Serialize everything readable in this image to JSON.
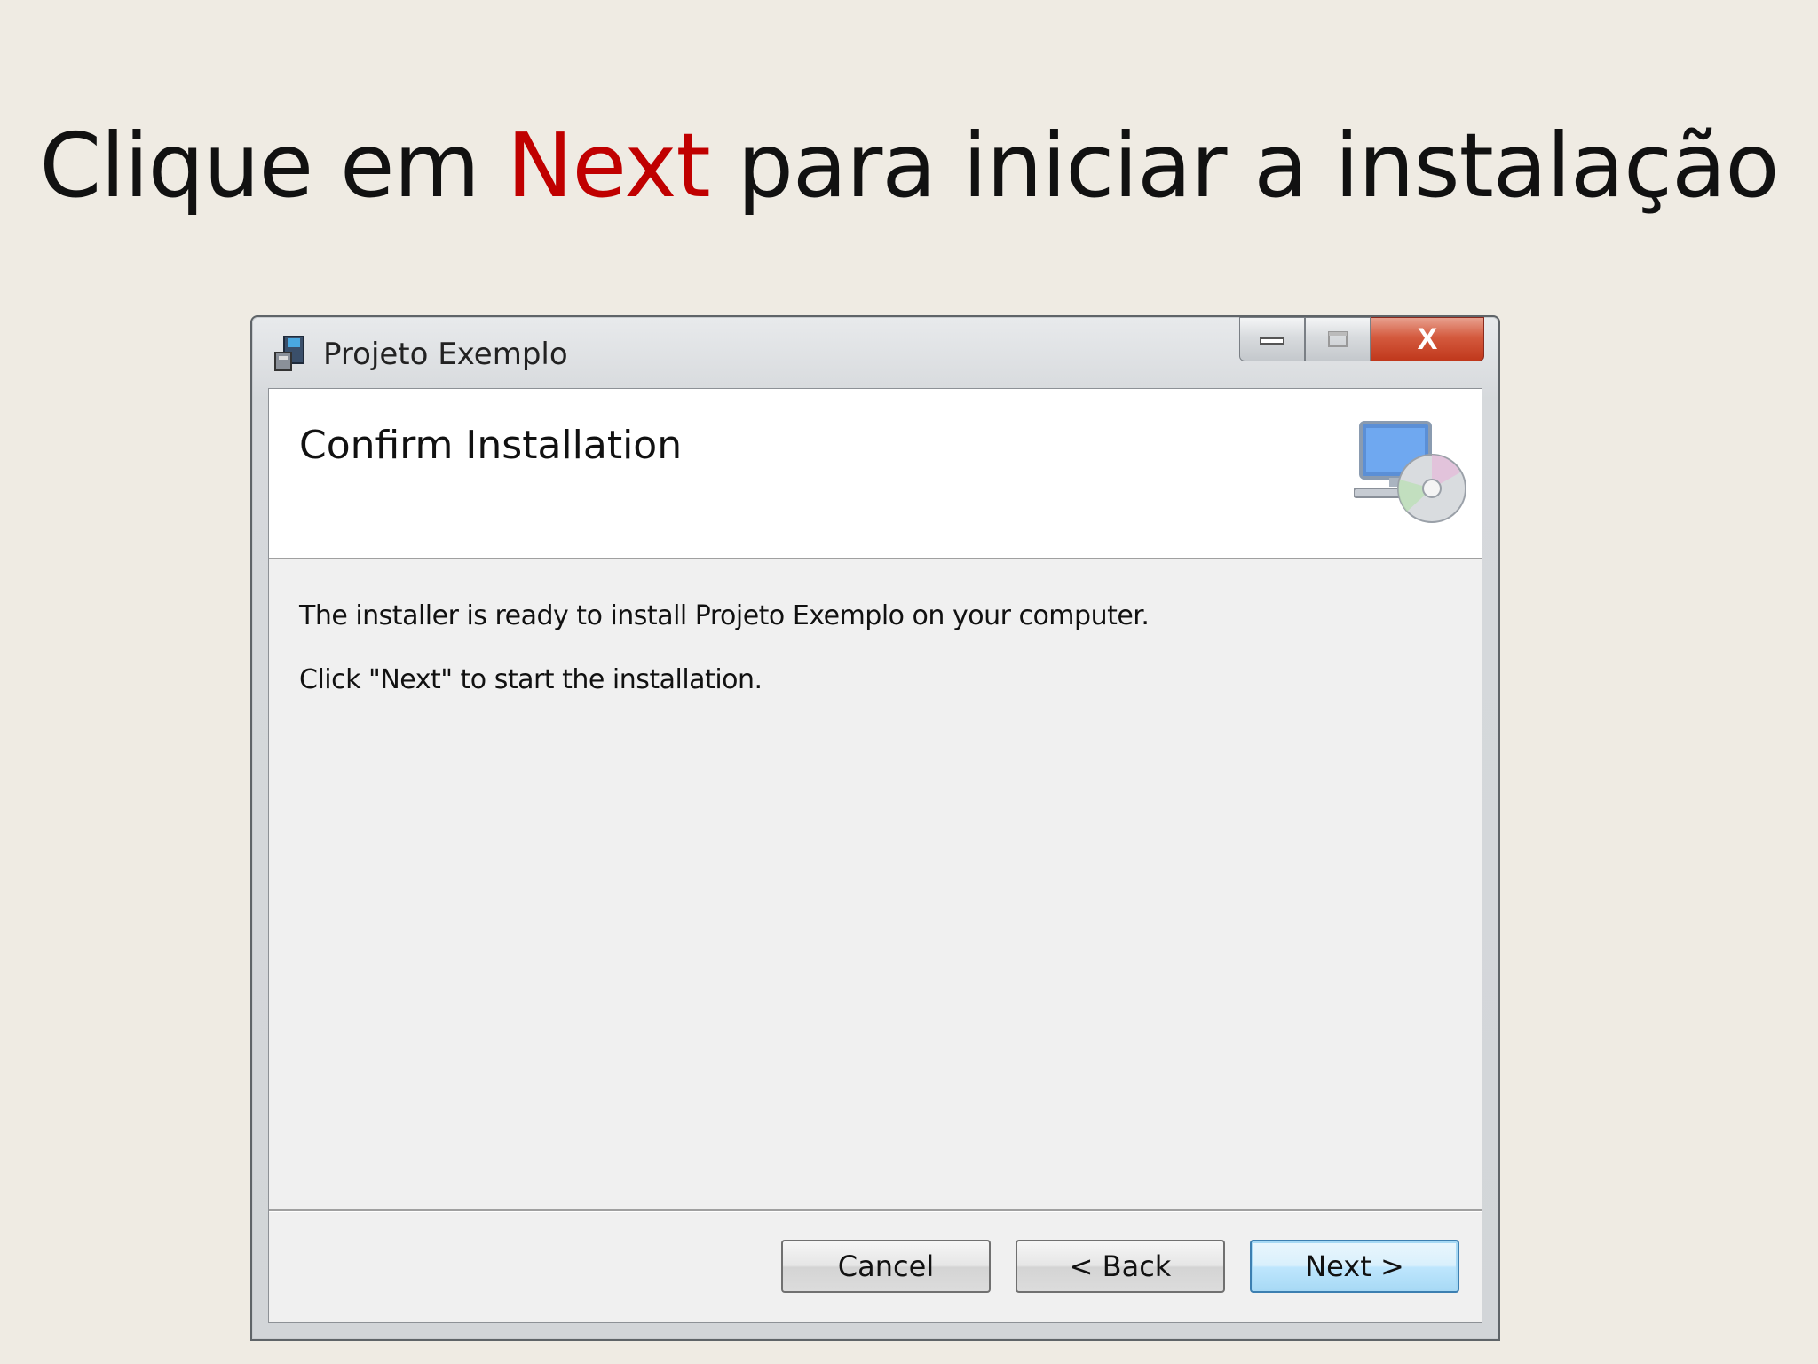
{
  "slide": {
    "title_before": "Clique em ",
    "title_highlight": "Next",
    "title_after": " para iniciar a instalação",
    "highlight_color": "#c00000"
  },
  "window": {
    "title": "Projeto Exemplo",
    "app_icon": "installer-icon",
    "controls": {
      "minimize": "minimize-icon",
      "maximize": "maximize-icon",
      "close_glyph": "X"
    }
  },
  "banner": {
    "title": "Confirm Installation",
    "icon": "computer-disc-icon"
  },
  "body": {
    "line1": "The installer is ready to install Projeto Exemplo on your computer.",
    "line2": "Click \"Next\" to start the installation."
  },
  "buttons": {
    "cancel": "Cancel",
    "back": "< Back",
    "next": "Next >"
  }
}
